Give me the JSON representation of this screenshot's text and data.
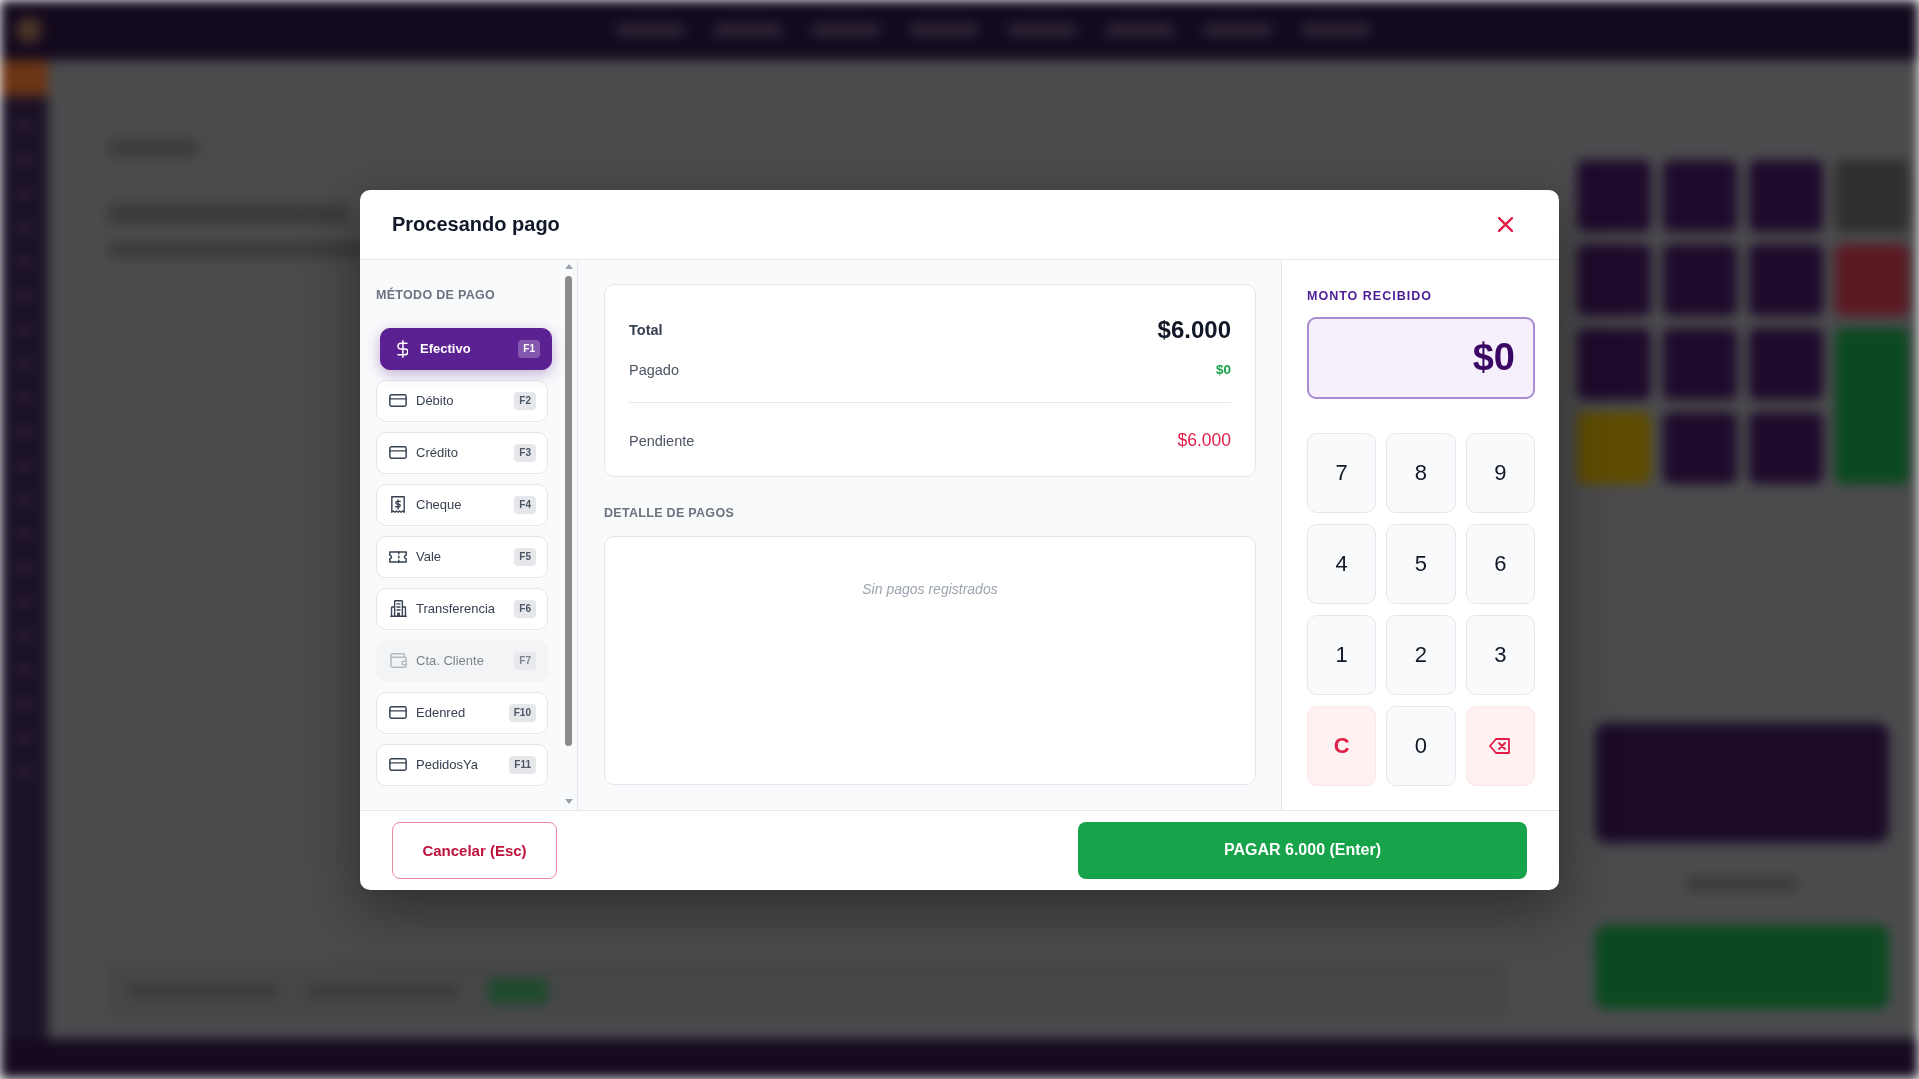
{
  "dialog": {
    "title": "Procesando pago"
  },
  "methods_panel": {
    "heading": "MÉTODO DE PAGO",
    "methods": [
      {
        "kind": "cash",
        "label": "Efectivo",
        "key": "F1",
        "selected": true,
        "disabled": false
      },
      {
        "kind": "card",
        "label": "Débito",
        "key": "F2",
        "selected": false,
        "disabled": false
      },
      {
        "kind": "card",
        "label": "Crédito",
        "key": "F3",
        "selected": false,
        "disabled": false
      },
      {
        "kind": "cheque",
        "label": "Cheque",
        "key": "F4",
        "selected": false,
        "disabled": false
      },
      {
        "kind": "voucher",
        "label": "Vale",
        "key": "F5",
        "selected": false,
        "disabled": false
      },
      {
        "kind": "transfer",
        "label": "Transferencia",
        "key": "F6",
        "selected": false,
        "disabled": false
      },
      {
        "kind": "account",
        "label": "Cta. Cliente",
        "key": "F7",
        "selected": false,
        "disabled": true
      },
      {
        "kind": "card",
        "label": "Edenred",
        "key": "F10",
        "selected": false,
        "disabled": false
      },
      {
        "kind": "card",
        "label": "PedidosYa",
        "key": "F11",
        "selected": false,
        "disabled": false
      }
    ]
  },
  "summary": {
    "total_label": "Total",
    "total_value": "$6.000",
    "paid_label": "Pagado",
    "paid_value": "$0",
    "pending_label": "Pendiente",
    "pending_value": "$6.000"
  },
  "payments_detail": {
    "heading": "DETALLE DE PAGOS",
    "empty_message": "Sin pagos registrados"
  },
  "amount_received": {
    "heading": "MONTO RECIBIDO",
    "value": "$0"
  },
  "keypad": [
    {
      "kind": "digit",
      "label": "7"
    },
    {
      "kind": "digit",
      "label": "8"
    },
    {
      "kind": "digit",
      "label": "9"
    },
    {
      "kind": "digit",
      "label": "4"
    },
    {
      "kind": "digit",
      "label": "5"
    },
    {
      "kind": "digit",
      "label": "6"
    },
    {
      "kind": "digit",
      "label": "1"
    },
    {
      "kind": "digit",
      "label": "2"
    },
    {
      "kind": "digit",
      "label": "3"
    },
    {
      "kind": "clear",
      "label": "C"
    },
    {
      "kind": "digit",
      "label": "0"
    },
    {
      "kind": "backspace"
    }
  ],
  "footer": {
    "cancel_button": "Cancelar (Esc)",
    "pay_button": "PAGAR 6.000 (Enter)"
  }
}
